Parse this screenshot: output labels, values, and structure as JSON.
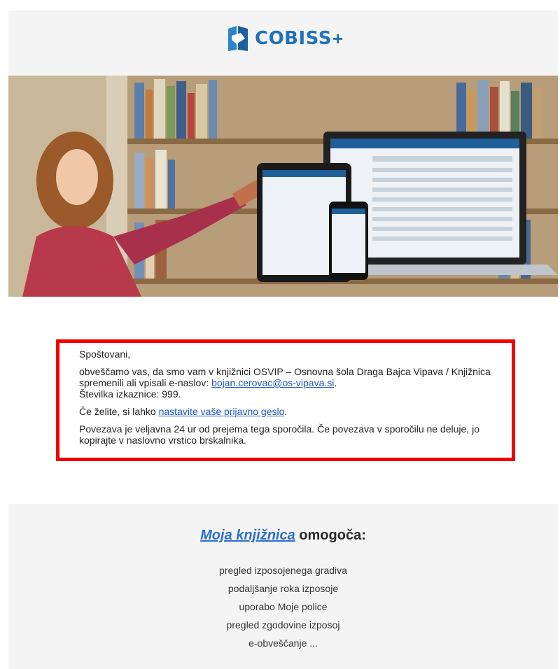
{
  "brand": {
    "name": "COBISS",
    "suffix": "+"
  },
  "notice": {
    "greeting": "Spoštovani,",
    "p1_before": "obveščamo vas, da smo vam v knjižnici OSVIP – Osnovna šola Draga Bajca Vipava / Knjižnica spremenili ali vpisali e-naslov: ",
    "email": "bojan.cerovac@os-vipava.si",
    "p1_after": ".",
    "card": "Številka izkaznice: 999.",
    "p2_before": "Če želite, si lahko ",
    "p2_link": "nastavite vaše prijavno geslo",
    "p2_after": ".",
    "p3": "Povezava je veljavna 24 ur od prejema tega sporočila. Če povezava v sporočilu ne deluje, jo kopirajte v naslovno vrstico brskalnika."
  },
  "features": {
    "title_link": "Moja knjižnica",
    "title_rest": " omogoča:",
    "items": [
      "pregled izposojenega gradiva",
      "podaljšanje roka izposoje",
      "uporabo Moje police",
      "pregled zgodovine izposoj",
      "e-obveščanje ..."
    ]
  },
  "colors": {
    "brand_blue": "#1f72b8",
    "highlight_border": "#f20000",
    "link": "#1a56c4"
  }
}
